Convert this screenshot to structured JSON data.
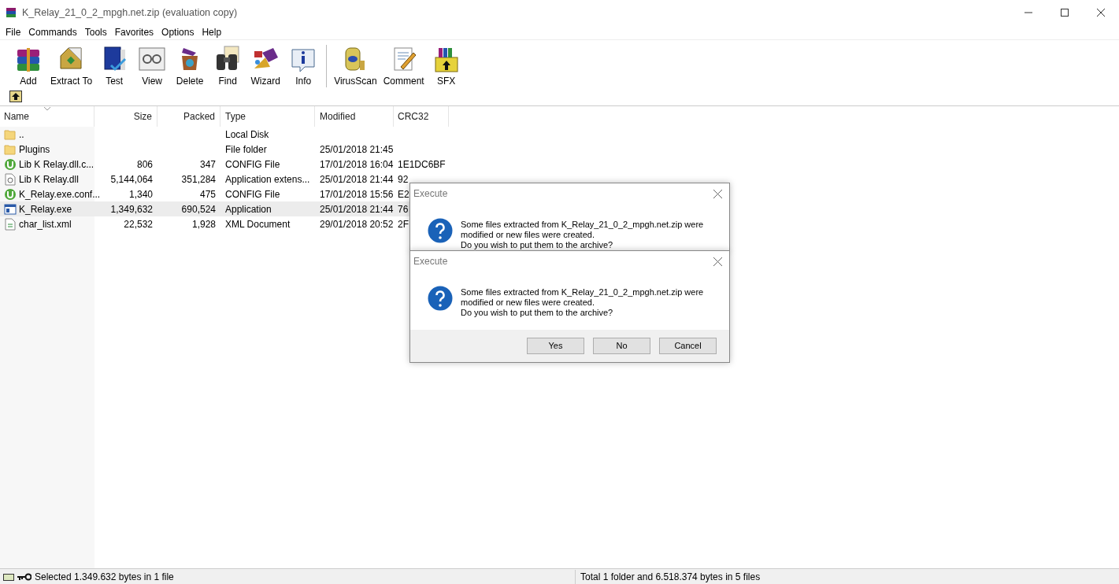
{
  "window": {
    "title": "K_Relay_21_0_2_mpgh.net.zip (evaluation copy)"
  },
  "menu": [
    "File",
    "Commands",
    "Tools",
    "Favorites",
    "Options",
    "Help"
  ],
  "toolbar": [
    {
      "label": "Add"
    },
    {
      "label": "Extract To"
    },
    {
      "label": "Test"
    },
    {
      "label": "View"
    },
    {
      "label": "Delete"
    },
    {
      "label": "Find"
    },
    {
      "label": "Wizard"
    },
    {
      "label": "Info"
    },
    {
      "label": "VirusScan",
      "group_start": true
    },
    {
      "label": "Comment"
    },
    {
      "label": "SFX"
    }
  ],
  "table": {
    "columns": [
      "Name",
      "Size",
      "Packed",
      "Type",
      "Modified",
      "CRC32"
    ],
    "rows": [
      {
        "kind": "folder",
        "selected": false,
        "cells": [
          "..",
          "",
          "",
          "Local Disk",
          "",
          ""
        ]
      },
      {
        "kind": "folder",
        "selected": false,
        "cells": [
          "Plugins",
          "",
          "",
          "File folder",
          "25/01/2018 21:45",
          ""
        ]
      },
      {
        "kind": "config",
        "selected": false,
        "cells": [
          "Lib K Relay.dll.c...",
          "806",
          "347",
          "CONFIG File",
          "17/01/2018 16:04",
          "1E1DC6BF"
        ]
      },
      {
        "kind": "dll",
        "selected": false,
        "cells": [
          "Lib K Relay.dll",
          "5,144,064",
          "351,284",
          "Application extens...",
          "25/01/2018 21:44",
          "92"
        ]
      },
      {
        "kind": "config",
        "selected": false,
        "cells": [
          "K_Relay.exe.conf...",
          "1,340",
          "475",
          "CONFIG File",
          "17/01/2018 15:56",
          "E2"
        ]
      },
      {
        "kind": "exe",
        "selected": true,
        "cells": [
          "K_Relay.exe",
          "1,349,632",
          "690,524",
          "Application",
          "25/01/2018 21:44",
          "76"
        ]
      },
      {
        "kind": "xml",
        "selected": false,
        "cells": [
          "char_list.xml",
          "22,532",
          "1,928",
          "XML Document",
          "29/01/2018 20:52",
          "2F"
        ]
      }
    ]
  },
  "dialogs": [
    {
      "title": "Execute",
      "lines": [
        "Some files extracted from K_Relay_21_0_2_mpgh.net.zip were",
        "modified or new files were created.",
        "Do you wish to put them to the archive?"
      ]
    },
    {
      "title": "Execute",
      "lines": [
        "Some files extracted from K_Relay_21_0_2_mpgh.net.zip were",
        "modified or new files were created.",
        "Do you wish to put them to the archive?"
      ],
      "buttons": [
        "Yes",
        "No",
        "Cancel"
      ]
    }
  ],
  "status_bar": {
    "left": "Selected 1.349.632 bytes in 1 file",
    "right": "Total 1 folder and 6.518.374 bytes in 5 files"
  }
}
